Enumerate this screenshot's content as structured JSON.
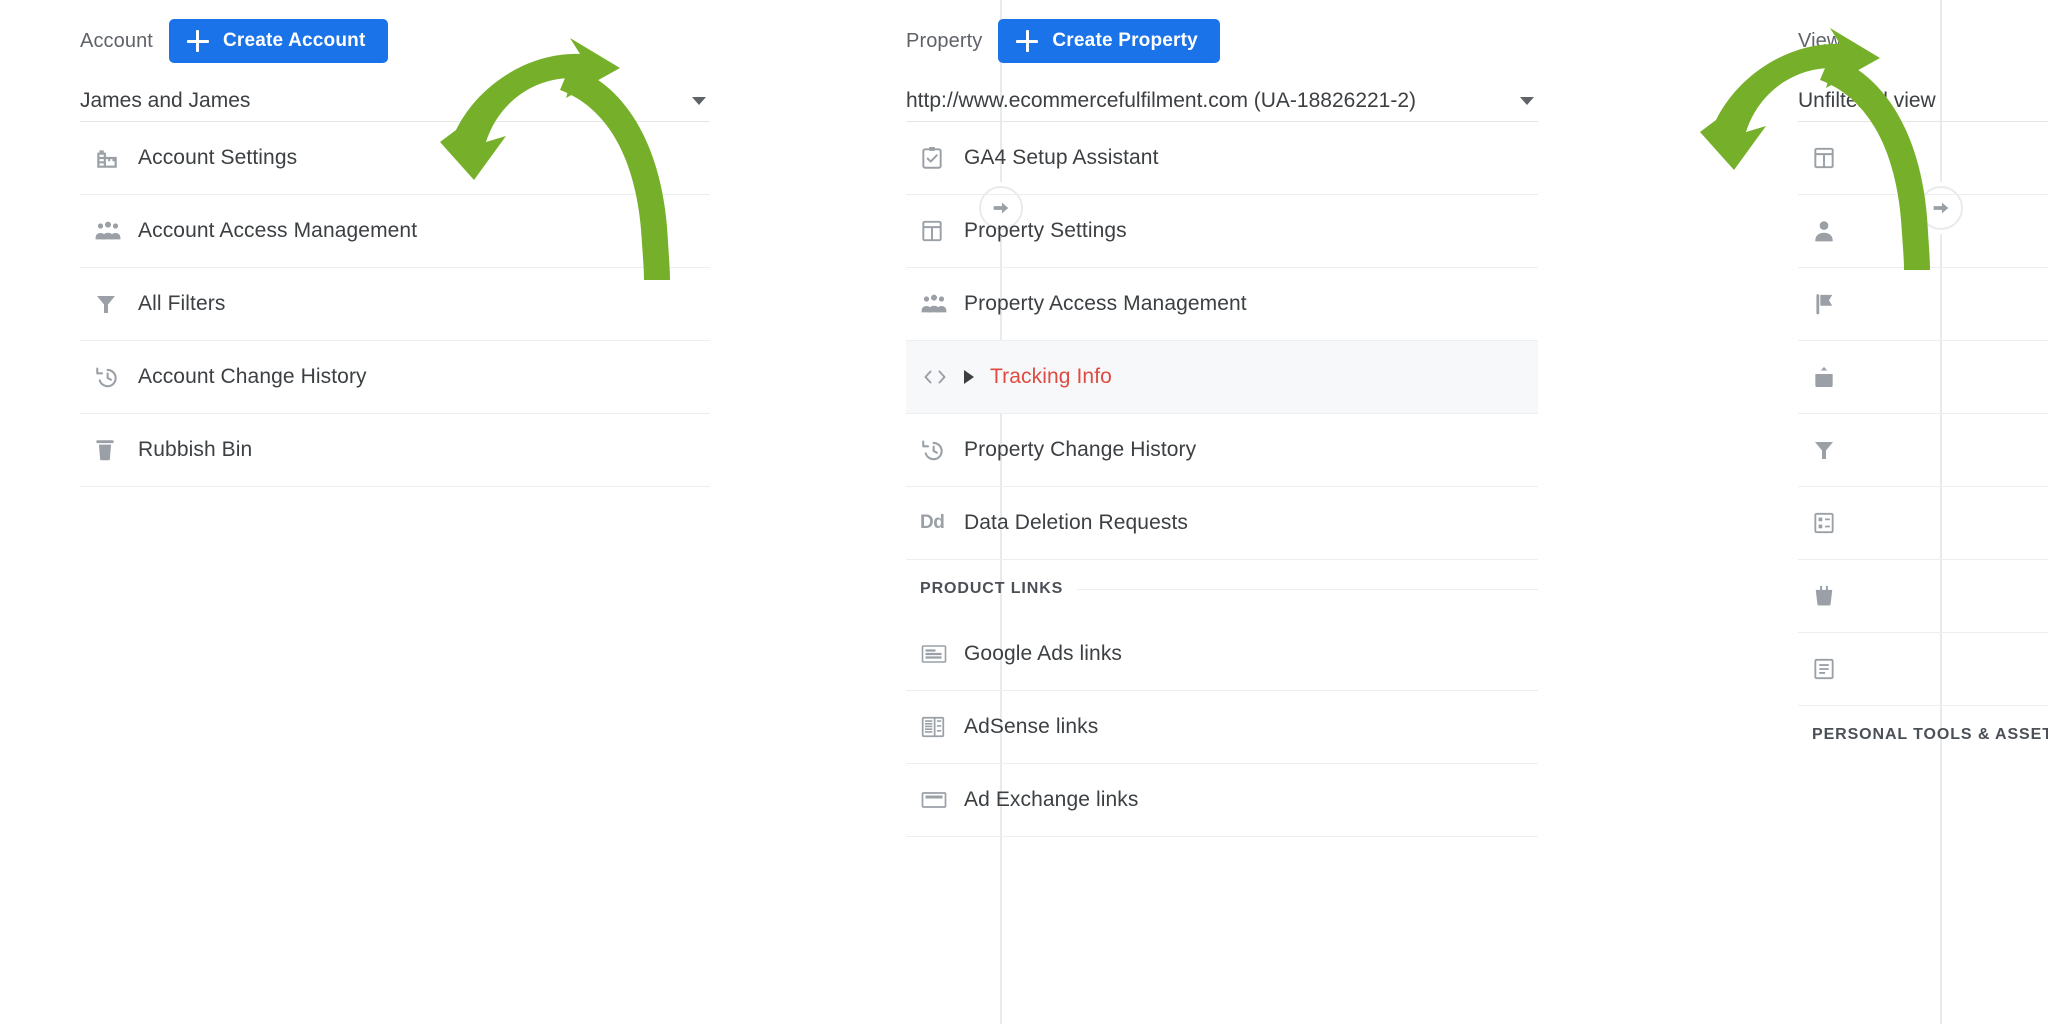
{
  "accent_blue": "#1a73e8",
  "annotation_green": "#76b02a",
  "active_red": "#e04a42",
  "account": {
    "header_label": "Account",
    "create_button": "Create Account",
    "selected": "James and James",
    "items": [
      {
        "label": "Account Settings",
        "icon": "building-icon"
      },
      {
        "label": "Account Access Management",
        "icon": "people-icon"
      },
      {
        "label": "All Filters",
        "icon": "funnel-icon"
      },
      {
        "label": "Account Change History",
        "icon": "history-icon"
      },
      {
        "label": "Rubbish Bin",
        "icon": "trash-icon"
      }
    ]
  },
  "property": {
    "header_label": "Property",
    "create_button": "Create Property",
    "selected": "http://www.ecommercefulfilment.com (UA-18826221-2)",
    "items": [
      {
        "label": "GA4 Setup Assistant",
        "icon": "clipboard-check-icon",
        "active": false,
        "expander": false
      },
      {
        "label": "Property Settings",
        "icon": "layout-icon",
        "active": false,
        "expander": false
      },
      {
        "label": "Property Access Management",
        "icon": "people-icon",
        "active": false,
        "expander": false
      },
      {
        "label": "Tracking Info",
        "icon": "code-icon",
        "active": true,
        "expander": true
      },
      {
        "label": "Property Change History",
        "icon": "history-icon",
        "active": false,
        "expander": false
      },
      {
        "label": "Data Deletion Requests",
        "icon": "dd-icon",
        "active": false,
        "expander": false
      }
    ],
    "section_label": "PRODUCT LINKS",
    "product_links": [
      {
        "label": "Google Ads links",
        "icon": "ads-card-icon"
      },
      {
        "label": "AdSense links",
        "icon": "adsense-icon"
      },
      {
        "label": "Ad Exchange links",
        "icon": "adexchange-icon"
      }
    ]
  },
  "view": {
    "header_label": "View",
    "selected": "Unfiltered view",
    "items": [
      {
        "icon": "gear-icon"
      },
      {
        "icon": "person-icon"
      },
      {
        "icon": "goal-flag-icon"
      },
      {
        "icon": "content-group-icon"
      },
      {
        "icon": "funnel-icon"
      },
      {
        "icon": "channel-settings-icon"
      },
      {
        "icon": "ecommerce-icon"
      },
      {
        "icon": "calculated-metric-icon"
      }
    ],
    "section_label": "PERSONAL TOOLS & ASSETS"
  },
  "dividers": [
    {
      "name": "account-property-divider",
      "knob": "arrow-right-icon"
    },
    {
      "name": "property-view-divider",
      "knob": "arrow-right-icon"
    }
  ]
}
